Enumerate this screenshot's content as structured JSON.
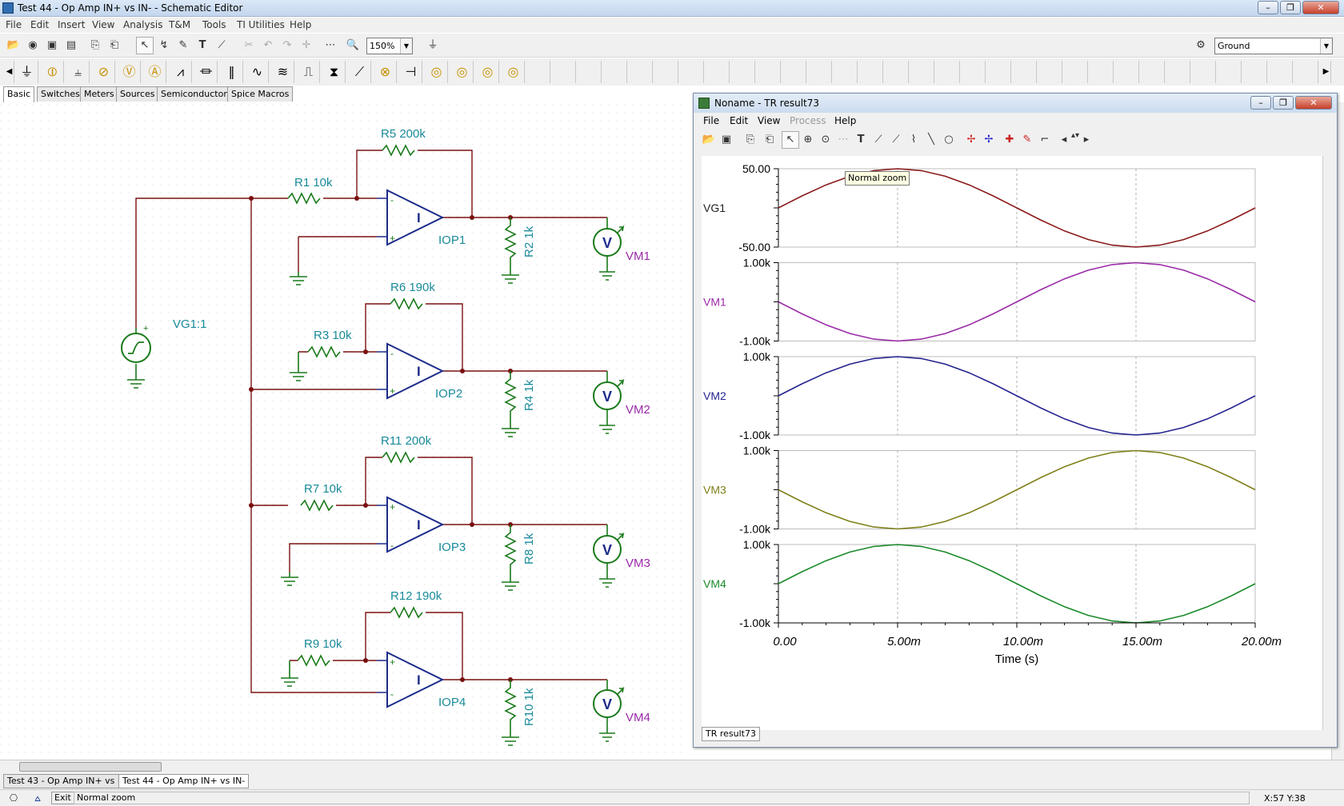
{
  "window": {
    "title": "Test 44 - Op Amp IN+ vs IN- - Schematic Editor"
  },
  "menu": [
    "File",
    "Edit",
    "Insert",
    "View",
    "Analysis",
    "T&M",
    "Tools",
    "TI Utilities",
    "Help"
  ],
  "toolbar": {
    "zoom": "150%",
    "component_select": "Ground"
  },
  "component_tabs": [
    "Basic",
    "Switches",
    "Meters",
    "Sources",
    "Semiconductors",
    "Spice Macros"
  ],
  "schematic": {
    "source": "VG1:1",
    "resistors": [
      "R1 10k",
      "R5 200k",
      "R2 1k",
      "R3 10k",
      "R6 190k",
      "R4 1k",
      "R7 10k",
      "R11 200k",
      "R8 1k",
      "R9 10k",
      "R12 190k",
      "R10 1k"
    ],
    "opamps": [
      "IOP1",
      "IOP2",
      "IOP3",
      "IOP4"
    ],
    "meters": [
      "VM1",
      "VM2",
      "VM3",
      "VM4"
    ],
    "meter_glyph": "V",
    "opamp_glyph": "I",
    "plus": "+",
    "minus": "-"
  },
  "doc_tabs": [
    "Test 43 - Op Amp IN+ vs IN-",
    "Test 44 - Op Amp IN+ vs IN-"
  ],
  "status": {
    "exit": "Exit",
    "message": "Normal zoom",
    "coords": "X:57 Y:38"
  },
  "result_window": {
    "title": "Noname - TR result73",
    "menu": [
      "File",
      "Edit",
      "View",
      "Process",
      "Help"
    ],
    "tooltip": "Normal zoom",
    "tab": "TR result73"
  },
  "colors": {
    "vg1": "#8b1a1a",
    "vm1": "#9a2aa8",
    "vm2": "#23238f",
    "vm3": "#7f7f1a",
    "vm4": "#1a8a2a",
    "schematic_wire": "#7a1010",
    "schematic_comp": "#1a7a1a",
    "schematic_text": "#1a8a9a"
  },
  "chart_data": {
    "type": "line",
    "x": [
      0,
      0.001,
      0.002,
      0.003,
      0.004,
      0.005,
      0.006,
      0.007,
      0.008,
      0.009,
      0.01,
      0.011,
      0.012,
      0.013,
      0.014,
      0.015,
      0.016,
      0.017,
      0.018,
      0.019,
      0.02
    ],
    "xlabel": "Time (s)",
    "xticks": [
      "0.00",
      "5.00m",
      "10.00m",
      "15.00m",
      "20.00m"
    ],
    "xlim": [
      0,
      0.02
    ],
    "grid": true,
    "series": [
      {
        "name": "VG1",
        "ticks": [
          "50.00",
          "-50.00"
        ],
        "ylim": [
          -50,
          50
        ],
        "values": [
          0,
          15.45,
          29.39,
          40.45,
          47.55,
          50,
          47.55,
          40.45,
          29.39,
          15.45,
          0,
          -15.45,
          -29.39,
          -40.45,
          -47.55,
          -50,
          -47.55,
          -40.45,
          -29.39,
          -15.45,
          0
        ]
      },
      {
        "name": "VM1",
        "ticks": [
          "1.00k",
          "-1.00k"
        ],
        "ylim": [
          -1000,
          1000
        ],
        "values": [
          0,
          -309,
          -588,
          -809,
          -951,
          -1000,
          -951,
          -809,
          -588,
          -309,
          0,
          309,
          588,
          809,
          951,
          1000,
          951,
          809,
          588,
          309,
          0
        ]
      },
      {
        "name": "VM2",
        "ticks": [
          "1.00k",
          "-1.00k"
        ],
        "ylim": [
          -1000,
          1000
        ],
        "values": [
          0,
          309,
          588,
          809,
          951,
          1000,
          951,
          809,
          588,
          309,
          0,
          -309,
          -588,
          -809,
          -951,
          -1000,
          -951,
          -809,
          -588,
          -309,
          0
        ]
      },
      {
        "name": "VM3",
        "ticks": [
          "1.00k",
          "-1.00k"
        ],
        "ylim": [
          -1000,
          1000
        ],
        "values": [
          0,
          -309,
          -588,
          -809,
          -951,
          -1000,
          -951,
          -809,
          -588,
          -309,
          0,
          309,
          588,
          809,
          951,
          1000,
          951,
          809,
          588,
          309,
          0
        ]
      },
      {
        "name": "VM4",
        "ticks": [
          "1.00k",
          "-1.00k"
        ],
        "ylim": [
          -1000,
          1000
        ],
        "values": [
          0,
          309,
          588,
          809,
          951,
          1000,
          951,
          809,
          588,
          309,
          0,
          -309,
          -588,
          -809,
          -951,
          -1000,
          -951,
          -809,
          -588,
          -309,
          0
        ]
      }
    ]
  }
}
